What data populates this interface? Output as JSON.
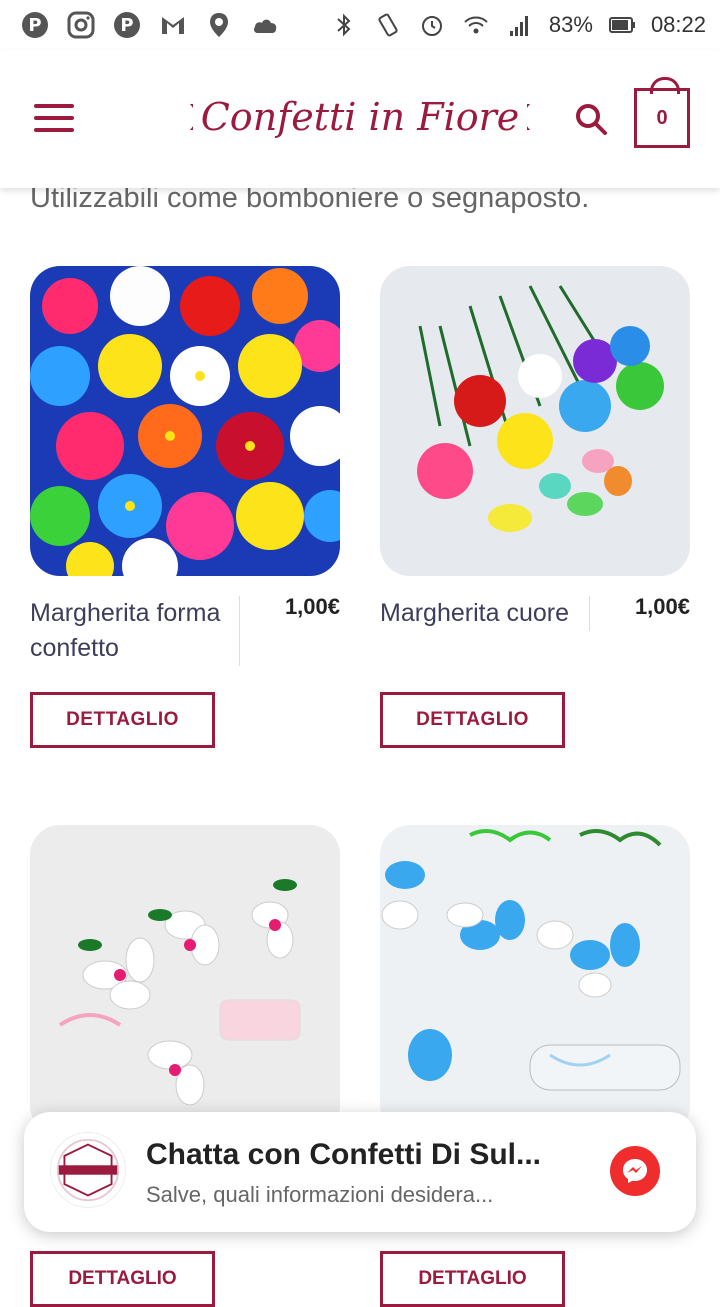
{
  "statusbar": {
    "battery": "83%",
    "time": "08:22"
  },
  "header": {
    "logo_text": "Confetti in Fiore",
    "cart_count": "0"
  },
  "intro_text": "Utilizzabili come bomboniere o segnaposto.",
  "products": [
    {
      "title": "Margherita forma confetto",
      "price": "1,00€",
      "button": "DETTAGLIO"
    },
    {
      "title": "Margherita cuore",
      "price": "1,00€",
      "button": "DETTAGLIO"
    },
    {
      "title": "",
      "price": "",
      "button": "DETTAGLIO"
    },
    {
      "title": "",
      "price": "",
      "button": "DETTAGLIO"
    }
  ],
  "chat": {
    "name": "Chatta con Confetti Di Sul...",
    "message": "Salve, quali informazioni desidera..."
  },
  "colors": {
    "brand": "#9b1b3f",
    "messenger": "#ef2d2d"
  }
}
